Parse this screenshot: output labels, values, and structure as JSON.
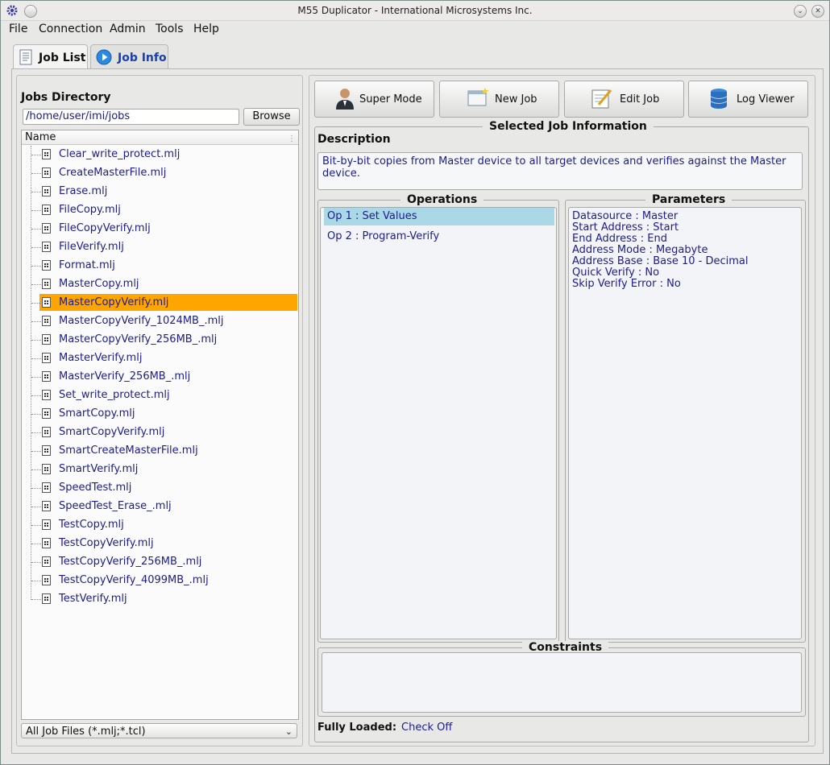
{
  "window": {
    "title": "M55 Duplicator - International Microsystems Inc."
  },
  "menu": [
    "File",
    "Connection",
    "Admin",
    "Tools",
    "Help"
  ],
  "tabs": [
    {
      "label": "Job List",
      "icon": "document-icon",
      "active": true
    },
    {
      "label": "Job Info",
      "icon": "play-circle-icon",
      "active": false
    }
  ],
  "left": {
    "jobs_directory_label": "Jobs Directory",
    "path": "/home/user/imi/jobs",
    "browse_label": "Browse",
    "column_header": "Name",
    "selected": "MasterCopyVerify.mlj",
    "files": [
      "Clear_write_protect.mlj",
      "CreateMasterFile.mlj",
      "Erase.mlj",
      "FileCopy.mlj",
      "FileCopyVerify.mlj",
      "FileVerify.mlj",
      "Format.mlj",
      "MasterCopy.mlj",
      "MasterCopyVerify.mlj",
      "MasterCopyVerify_1024MB_.mlj",
      "MasterCopyVerify_256MB_.mlj",
      "MasterVerify.mlj",
      "MasterVerify_256MB_.mlj",
      "Set_write_protect.mlj",
      "SmartCopy.mlj",
      "SmartCopyVerify.mlj",
      "SmartCreateMasterFile.mlj",
      "SmartVerify.mlj",
      "SpeedTest.mlj",
      "SpeedTest_Erase_.mlj",
      "TestCopy.mlj",
      "TestCopyVerify.mlj",
      "TestCopyVerify_256MB_.mlj",
      "TestCopyVerify_4099MB_.mlj",
      "TestVerify.mlj"
    ],
    "filter": "All Job Files (*.mlj;*.tcl)"
  },
  "toolbar": [
    {
      "label": "Super Mode",
      "icon": "user-icon"
    },
    {
      "label": "New Job",
      "icon": "new-window-icon"
    },
    {
      "label": "Edit Job",
      "icon": "edit-notepad-icon"
    },
    {
      "label": "Log Viewer",
      "icon": "database-icon"
    }
  ],
  "selected_job": {
    "group_title": "Selected Job Information",
    "description_label": "Description",
    "description": "Bit-by-bit copies from Master device to all target devices and verifies against the Master device.",
    "operations_title": "Operations",
    "operations": [
      "Op 1 : Set Values",
      "Op 2 : Program-Verify"
    ],
    "parameters_title": "Parameters",
    "parameters": [
      "Datasource : Master",
      "Start Address : Start",
      "End Address : End",
      "Address Mode : Megabyte",
      "Address Base : Base 10 - Decimal",
      "Quick Verify : No",
      "Skip Verify Error : No"
    ],
    "constraints_title": "Constraints",
    "fully_loaded_label": "Fully Loaded:",
    "fully_loaded_value": "Check Off"
  },
  "colors": {
    "selection": "#ffa500",
    "op_selection": "#aad8e6",
    "link_text": "#1c1c8e"
  }
}
